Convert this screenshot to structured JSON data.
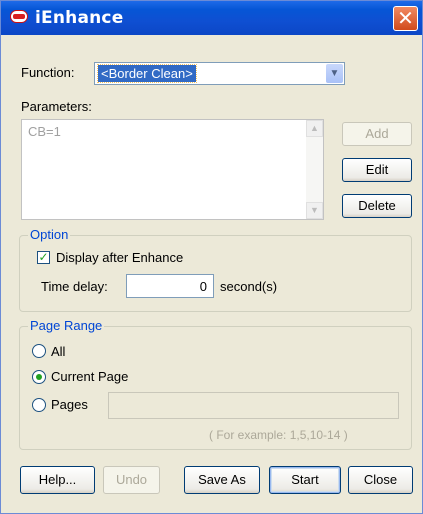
{
  "window": {
    "title": "iEnhance",
    "close_glyph": "✕"
  },
  "function": {
    "label": "Function:",
    "selected": "<Border Clean>"
  },
  "parameters": {
    "label": "Parameters:",
    "items": [
      "CB=1"
    ],
    "add_label": "Add",
    "edit_label": "Edit",
    "delete_label": "Delete"
  },
  "option": {
    "title": "Option",
    "display_after_enhance_label": "Display after Enhance",
    "display_after_enhance_checked": true,
    "time_delay_label": "Time delay:",
    "time_delay_value": "0",
    "time_delay_unit": "second(s)"
  },
  "page_range": {
    "title": "Page Range",
    "all_label": "All",
    "current_page_label": "Current Page",
    "pages_label": "Pages",
    "selected": "current_page",
    "pages_value": "",
    "hint": "( For example: 1,5,10-14 )"
  },
  "footer": {
    "help_label": "Help...",
    "undo_label": "Undo",
    "save_as_label": "Save As",
    "start_label": "Start",
    "close_label": "Close"
  },
  "colors": {
    "titlebar": "#0c47c6",
    "window_bg": "#ece9d8",
    "group_title": "#0046d5",
    "selection": "#316ac5",
    "close_button": "#d14a1c"
  }
}
